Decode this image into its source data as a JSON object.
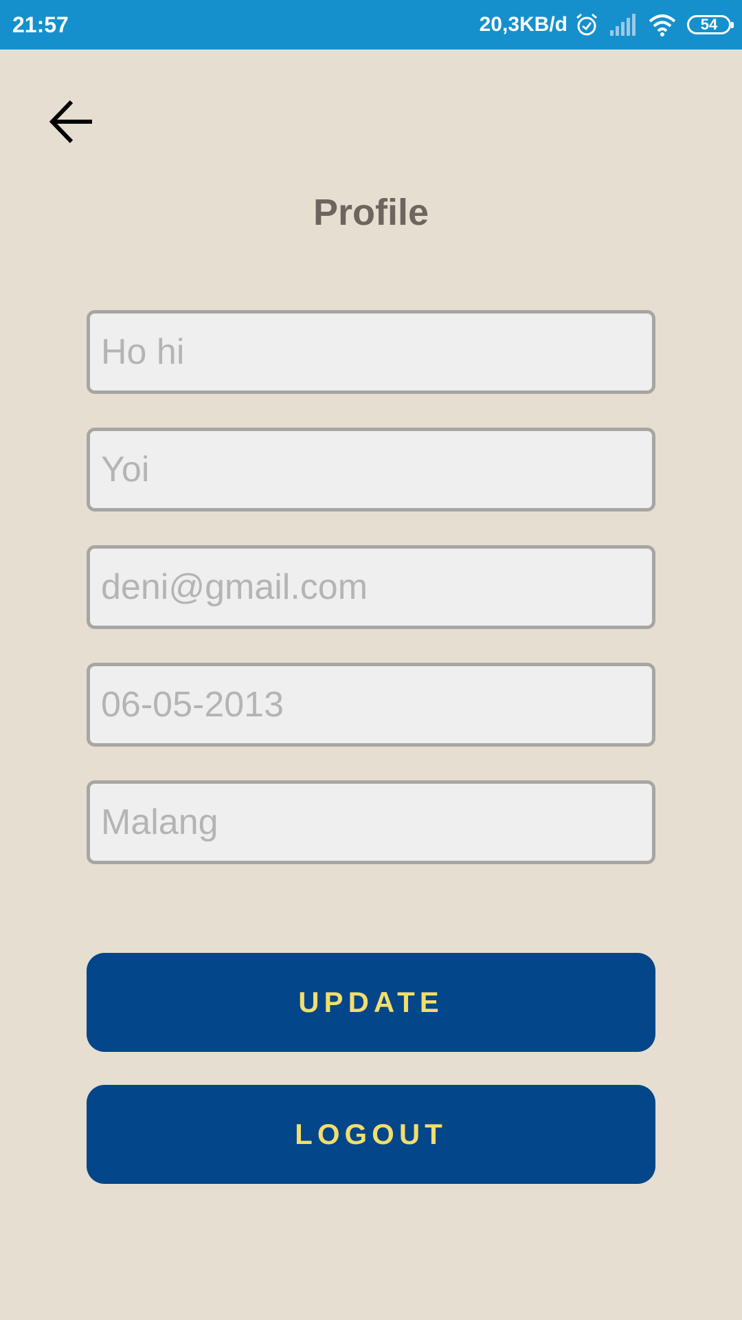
{
  "status_bar": {
    "time": "21:57",
    "net_speed": "20,3KB/d",
    "battery": "54",
    "icons": [
      "alarm-icon",
      "signal-icon",
      "wifi-icon",
      "battery-icon"
    ]
  },
  "nav": {
    "back_icon": "arrow-left-icon"
  },
  "page": {
    "title": "Profile"
  },
  "form": {
    "fields": [
      {
        "placeholder": "Ho hi"
      },
      {
        "placeholder": "Yoi"
      },
      {
        "placeholder": "deni@gmail.com"
      },
      {
        "placeholder": "06-05-2013"
      },
      {
        "placeholder": "Malang"
      }
    ]
  },
  "buttons": {
    "update_label": "UPDATE",
    "logout_label": "LOGOUT"
  },
  "colors": {
    "status_bar": "#1590cc",
    "background": "#e6dfd1",
    "button": "#03468a",
    "button_text": "#f3de6c",
    "title": "#6d665f"
  }
}
